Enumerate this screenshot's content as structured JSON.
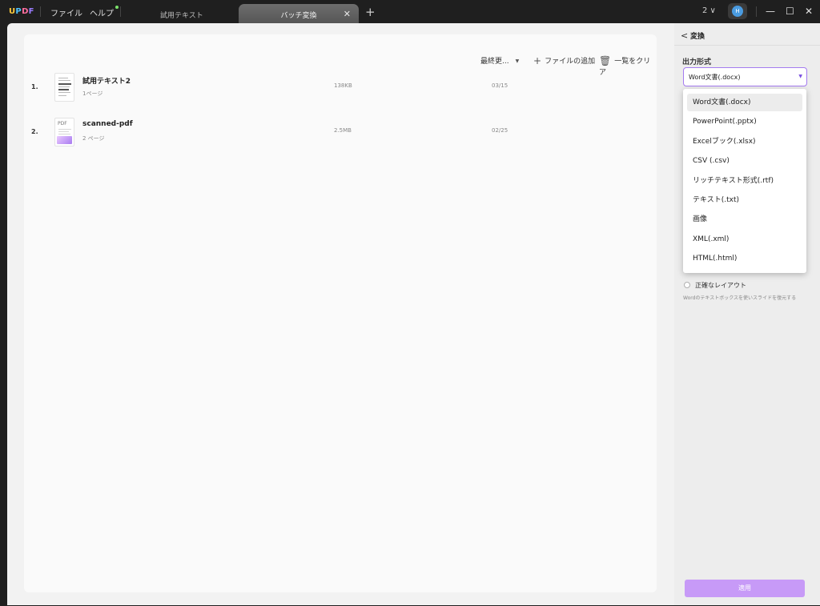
{
  "app": {
    "logo": "UPDF"
  },
  "titlebar": {
    "menus": [
      "ファイル",
      "ヘルプ"
    ],
    "tabs": [
      {
        "label": "試用テキスト",
        "active": false
      },
      {
        "label": "バッチ変換",
        "active": true
      }
    ],
    "close_tab_glyph": "✕",
    "new_tab_glyph": "+",
    "window_count": "2 ∨",
    "avatar_initial": "H",
    "window_controls": {
      "minimize": "—",
      "maximize": "☐",
      "close": "✕"
    }
  },
  "toolbar": {
    "sort_label": "最終更...",
    "sort_arrow": "▼",
    "add_icon": "+",
    "add_label": "ファイルの追加",
    "clear_icon": "🗑",
    "clear_label": "一覧をクリア"
  },
  "files": [
    {
      "index": "1.",
      "name": "試用テキスト2",
      "pages": "1ページ",
      "size": "138KB",
      "date": "03/15",
      "thumb": "text"
    },
    {
      "index": "2.",
      "name": "scanned-pdf",
      "pages": "2 ページ",
      "size": "2.5MB",
      "date": "02/25",
      "thumb": "pdf"
    }
  ],
  "thumb_pdf_label": "PDF",
  "sidebar": {
    "back_glyph": "<",
    "title": "変換",
    "format_label": "出力形式",
    "format_value": "Word文書(.docx)",
    "format_arrow": "▼",
    "radio_label": "正確なレイアウト",
    "radio_desc": "Wordのテキストボックスを使いスライドを復元する",
    "apply_label": "適用"
  },
  "dropdown": {
    "options": [
      "Word文書(.docx)",
      "PowerPoint(.pptx)",
      "Excelブック(.xlsx)",
      "CSV (.csv)",
      "リッチテキスト形式(.rtf)",
      "テキスト(.txt)",
      "画像",
      "XML(.xml)",
      "HTML(.html)"
    ],
    "selected_index": 0
  },
  "colors": {
    "accent": "#a47bf0",
    "apply_button": "#c79af7",
    "titlebar": "#1f1f1f",
    "workspace": "#f2f2f2"
  }
}
